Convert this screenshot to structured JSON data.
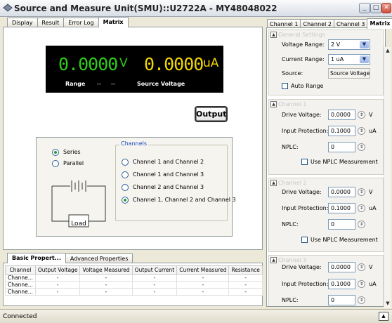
{
  "window": {
    "title": "Source and Measure Unit(SMU)::U2722A - MY48048022"
  },
  "main_tabs": [
    "Display",
    "Result",
    "Error Log",
    "Matrix"
  ],
  "active_main_tab": "Matrix",
  "display": {
    "voltage_value": "0.0000",
    "voltage_unit": "V",
    "current_value": "0.0000",
    "current_unit": "uA",
    "range_label": "Range",
    "range_value1": "--",
    "range_value2": "--",
    "mode_label": "Source Voltage",
    "voltage_color": "#2ecc1a",
    "current_color": "#f2d600"
  },
  "output_button": "Output",
  "connection": {
    "series_label": "Series",
    "parallel_label": "Parallel",
    "selected": "Series",
    "load_label": "Load",
    "channels_title": "Channels",
    "channel_options": [
      "Channel 1 and Channel 2",
      "Channel 1 and Channel 3",
      "Channel 2 and Channel 3",
      "Channel 1, Channel 2 and Channel 3"
    ],
    "channel_selected_index": 3
  },
  "bottom_tabs": [
    "Basic Propert...",
    "Advanced Properties"
  ],
  "table": {
    "headers": [
      "Channel",
      "Output Voltage",
      "Voltage Measured",
      "Output Current",
      "Current Measured",
      "Resistance"
    ],
    "rows": [
      [
        "Channe...",
        "-",
        "-",
        "-",
        "-",
        "-"
      ],
      [
        "Channe...",
        "-",
        "-",
        "-",
        "-",
        "-"
      ],
      [
        "Channe...",
        "-",
        "-",
        "-",
        "-",
        "-"
      ]
    ]
  },
  "status": {
    "text": "Connected"
  },
  "right_tabs": [
    "Channel 1",
    "Channel 2",
    "Channel 3",
    "Matrix"
  ],
  "active_right_tab": "Matrix",
  "general": {
    "title": "General Settings",
    "voltage_range_label": "Voltage Range:",
    "voltage_range_value": "2 V",
    "current_range_label": "Current Range:",
    "current_range_value": "1 uA",
    "source_label": "Source:",
    "source_value": "Source Voltage",
    "auto_range_label": "Auto Range"
  },
  "channel_groups": [
    {
      "title": "Channel 1",
      "drive_label": "Drive Voltage:",
      "drive_value": "0.0000",
      "drive_unit": "V",
      "prot_label": "Input Protection:",
      "prot_value": "0.1000",
      "prot_unit": "uA",
      "nplc_label": "NPLC:",
      "nplc_value": "0",
      "use_label": "Use NPLC Measurement"
    },
    {
      "title": "Channel 2",
      "drive_label": "Drive Voltage:",
      "drive_value": "0.0000",
      "drive_unit": "V",
      "prot_label": "Input Protection:",
      "prot_value": "0.1000",
      "prot_unit": "uA",
      "nplc_label": "NPLC:",
      "nplc_value": "0",
      "use_label": "Use NPLC Measurement"
    },
    {
      "title": "Channel 3",
      "drive_label": "Drive Voltage:",
      "drive_value": "0.0000",
      "drive_unit": "V",
      "prot_label": "Input Protection:",
      "prot_value": "0.1000",
      "prot_unit": "uA",
      "nplc_label": "NPLC:",
      "nplc_value": "0"
    }
  ]
}
